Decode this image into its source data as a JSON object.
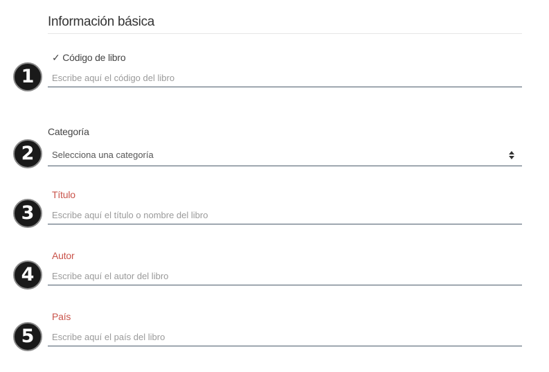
{
  "section": {
    "title": "Información básica"
  },
  "fields": [
    {
      "badge": "1",
      "check": "✓",
      "label": "Código de libro",
      "placeholder": "Escribe aquí el código del libro"
    },
    {
      "badge": "2",
      "label": "Categoría",
      "selected": "Selecciona una categoría"
    },
    {
      "badge": "3",
      "label": "Título",
      "placeholder": "Escribe aquí el título o nombre del libro"
    },
    {
      "badge": "4",
      "label": "Autor",
      "placeholder": "Escribe aquí el autor del libro"
    },
    {
      "badge": "5",
      "label": "País",
      "placeholder": "Escribe aquí el país del libro"
    }
  ],
  "colors": {
    "required_label": "#c9534a",
    "underline": "#4a5a6a",
    "badge_bg": "#1a1a1a"
  }
}
